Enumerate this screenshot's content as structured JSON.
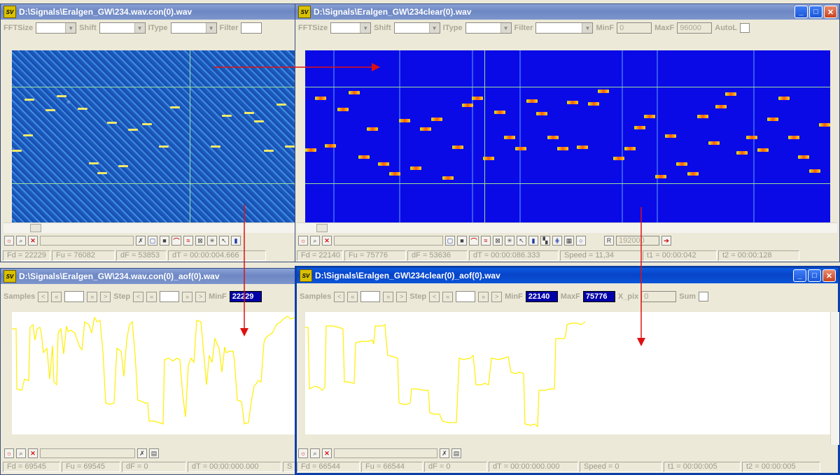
{
  "windows": {
    "w1": {
      "title": "D:\\Signals\\Eralgen_GW\\234.wav.con(0).wav",
      "toolbar": [
        "FFTSize",
        "Shift",
        "IType",
        "Filter"
      ],
      "status": {
        "fd": "Fd = 22229",
        "fu": "Fu = 76082",
        "df": "dF = 53853",
        "dt": "dT = 00:00:004.666"
      }
    },
    "w2": {
      "title": "D:\\Signals\\Eralgen_GW\\234clear(0).wav",
      "toolbar": {
        "fftsize": "FFTSize",
        "shift": "Shift",
        "itype": "IType",
        "filter": "Filter",
        "minf_label": "MinF",
        "minf_value": "0",
        "maxf_label": "MaxF",
        "maxf_value": "96000",
        "autol": "AutoL"
      },
      "rate_value": "192000",
      "status": {
        "fd": "Fd = 22140",
        "fu": "Fu = 75776",
        "df": "dF = 53636",
        "dt": "dT = 00:00:086.333",
        "speed": "Speed = 11,34",
        "t1": "t1 = 00:00:042",
        "t2": "t2 = 00:00:128"
      }
    },
    "w3": {
      "title": "D:\\Signals\\Eralgen_GW\\234.wav.con(0)_aof(0).wav",
      "toolbar": {
        "samples": "Samples",
        "step": "Step",
        "minf_label": "MinF",
        "minf_value": "22229"
      },
      "status": {
        "fd": "Fd = 69545",
        "fu": "Fu = 69545",
        "df": "dF = 0",
        "dt": "dT = 00:00:000.000",
        "s": "S"
      }
    },
    "w4": {
      "title": "D:\\Signals\\Eralgen_GW\\234clear(0)_aof(0).wav",
      "toolbar": {
        "samples": "Samples",
        "step": "Step",
        "minf_label": "MinF",
        "minf_value": "22140",
        "maxf_label": "MaxF",
        "maxf_value": "75776",
        "xpix_label": "X_pix",
        "xpix_value": "0",
        "sum": "Sum"
      },
      "status": {
        "fd": "Fd = 66544",
        "fu": "Fu = 66544",
        "df": "dF = 0",
        "dt": "dT = 00:00:000.000",
        "speed": "Speed = 0",
        "t1": "t1 = 00:00:005",
        "t2": "t2 = 00:00:005"
      }
    }
  },
  "app_icon": "SV",
  "colors": {
    "trace": "#ffef00",
    "accent_blue": "#0a56d8",
    "spectrogram_clean": "#0a0ae6",
    "annotation_arrow": "#e01010"
  }
}
